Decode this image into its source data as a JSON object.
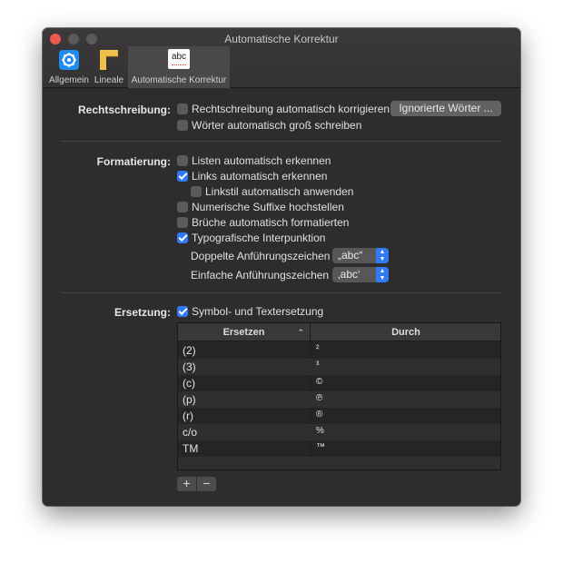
{
  "window": {
    "title": "Automatische Korrektur"
  },
  "toolbar": {
    "items": [
      {
        "label": "Allgemein"
      },
      {
        "label": "Lineale"
      },
      {
        "label": "Automatische Korrektur",
        "icon_text": "abc"
      }
    ]
  },
  "spelling": {
    "label": "Rechtschreibung:",
    "auto_correct": {
      "label": "Rechtschreibung automatisch korrigieren",
      "checked": false
    },
    "ignored_button": "Ignorierte Wörter ...",
    "auto_capitalize": {
      "label": "Wörter automatisch groß schreiben",
      "checked": false
    }
  },
  "formatting": {
    "label": "Formatierung:",
    "lists": {
      "label": "Listen automatisch erkennen",
      "checked": false
    },
    "links": {
      "label": "Links automatisch erkennen",
      "checked": true
    },
    "linkstyle": {
      "label": "Linkstil automatisch anwenden",
      "checked": false
    },
    "suffixes": {
      "label": "Numerische Suffixe hochstellen",
      "checked": false
    },
    "fractions": {
      "label": "Brüche automatisch formatierten",
      "checked": false
    },
    "typographic": {
      "label": "Typografische Interpunktion",
      "checked": true
    },
    "double_quotes": {
      "label": "Doppelte Anführungszeichen",
      "value": "„abc“"
    },
    "single_quotes": {
      "label": "Einfache Anführungszeichen",
      "value": "‚abc‘"
    }
  },
  "replacement": {
    "label": "Ersetzung:",
    "symbol_text": {
      "label": "Symbol- und Textersetzung",
      "checked": true
    },
    "columns": {
      "replace": "Ersetzen",
      "with": "Durch"
    },
    "rows": [
      {
        "replace": "(2)",
        "with": "²"
      },
      {
        "replace": "(3)",
        "with": "³"
      },
      {
        "replace": "(c)",
        "with": "©"
      },
      {
        "replace": "(p)",
        "with": "℗"
      },
      {
        "replace": "(r)",
        "with": "®"
      },
      {
        "replace": "c/o",
        "with": "%"
      },
      {
        "replace": "TM",
        "with": "™"
      }
    ],
    "add_label": "+",
    "remove_label": "−"
  },
  "colors": {
    "accent": "#2f7bf5",
    "close": "#ee5a52",
    "window_bg": "#2e2c2c"
  }
}
